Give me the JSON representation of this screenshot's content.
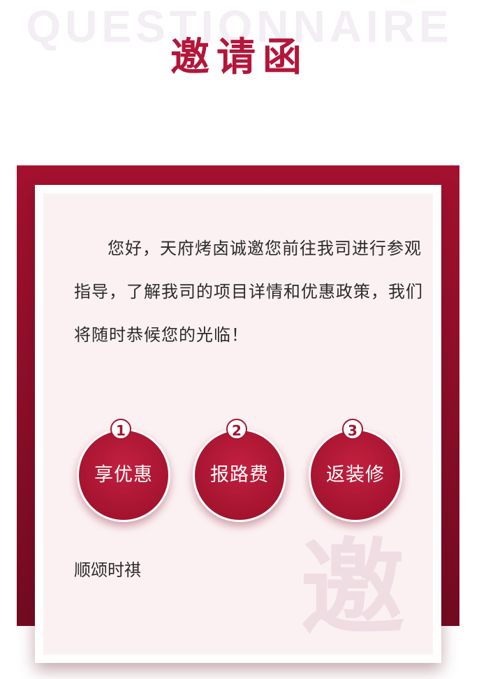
{
  "header": {
    "watermark": "QUESTIONNAIRE",
    "title": "邀请函"
  },
  "invitation": {
    "intro": "您好，天府烤卤诚邀您前往我司进行参观指导，了解我司的项目详情和优惠政策，我们将随时恭候您的光临！",
    "benefits": [
      {
        "number": "1",
        "label": "享优惠"
      },
      {
        "number": "2",
        "label": "报路费"
      },
      {
        "number": "3",
        "label": "返装修"
      }
    ],
    "closing": "顺颂时祺",
    "decoration_char": "邀"
  },
  "colors": {
    "accent": "#b3163a",
    "frame": "#8a0e28",
    "card_background": "#fcf1f2"
  }
}
